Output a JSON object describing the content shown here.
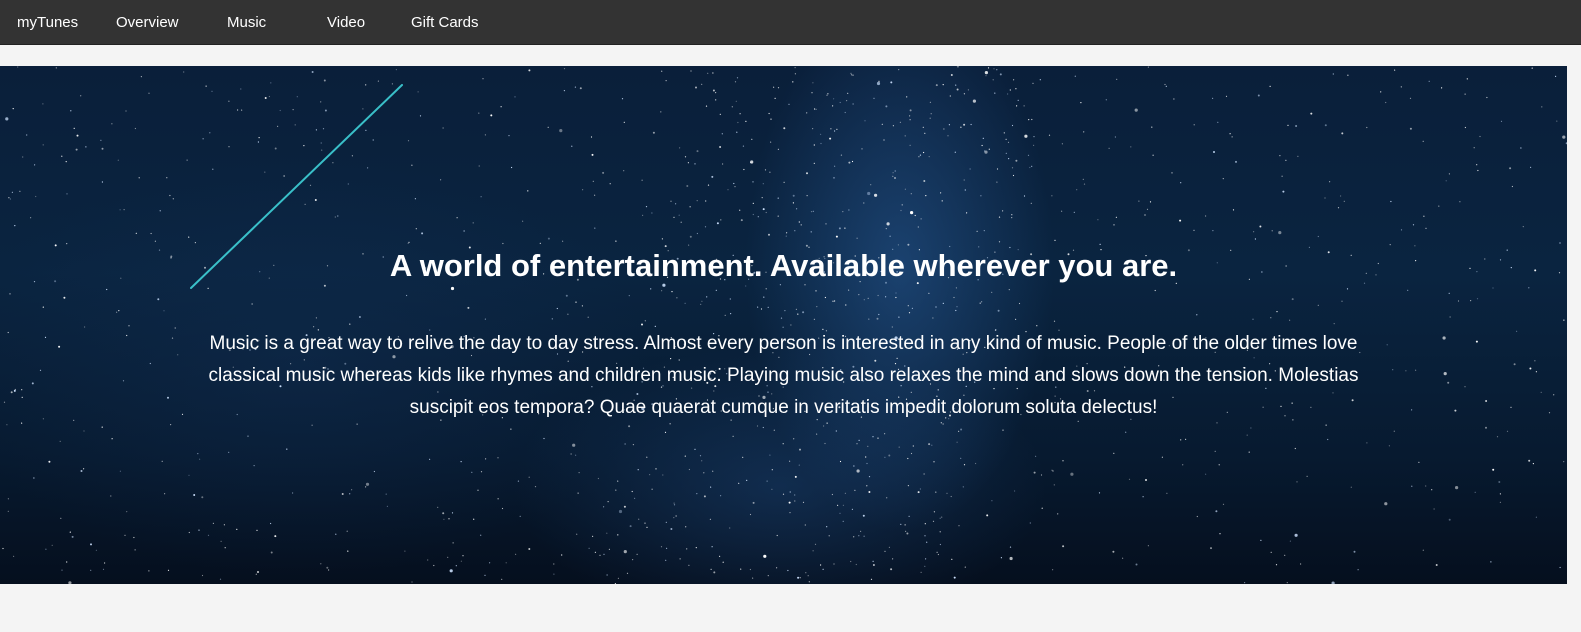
{
  "nav": {
    "brand": "myTunes",
    "links": [
      "Overview",
      "Music",
      "Video",
      "Gift Cards"
    ]
  },
  "hero": {
    "title": "A world of entertainment. Available wherever you are.",
    "body": "Music is a great way to relive the day to day stress. Almost every person is interested in any kind of music. People of the older times love classical music whereas kids like rhymes and children music. Playing music also relaxes the mind and slows down the tension. Molestias suscipit eos tempora? Quae quaerat cumque in veritatis impedit dolorum soluta delectus!"
  },
  "colors": {
    "navbar": "#333333",
    "page_background": "#f4f4f4",
    "hero_text": "#ffffff",
    "shooting_star": "#3fd1d8"
  }
}
